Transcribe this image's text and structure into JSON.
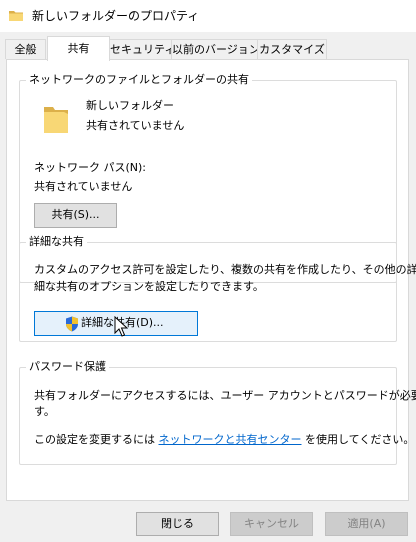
{
  "window": {
    "title": "新しいフォルダーのプロパティ",
    "icon": "folder-icon"
  },
  "tabs": [
    {
      "label": "全般",
      "active": false
    },
    {
      "label": "共有",
      "active": true
    },
    {
      "label": "セキュリティ",
      "active": false
    },
    {
      "label": "以前のバージョン",
      "active": false
    },
    {
      "label": "カスタマイズ",
      "active": false
    }
  ],
  "network_share": {
    "title": "ネットワークのファイルとフォルダーの共有",
    "folder_name": "新しいフォルダー",
    "folder_status": "共有されていません",
    "network_path_label": "ネットワーク パス(N):",
    "network_path_value": "共有されていません",
    "share_button": "共有(S)..."
  },
  "advanced_share": {
    "title": "詳細な共有",
    "description_line1": "カスタムのアクセス許可を設定したり、複数の共有を作成したり、その他の詳",
    "description_line2": "細な共有のオプションを設定したりできます。",
    "button": "詳細な共有(D)...",
    "button_icon": "uac-shield-icon"
  },
  "password_protection": {
    "title": "パスワード保護",
    "line1": "共有フォルダーにアクセスするには、ユーザー アカウントとパスワードが必要で",
    "line2": "す。",
    "line3_prefix": "この設定を変更するには ",
    "line3_link": "ネットワークと共有センター",
    "line3_suffix": " を使用してください。"
  },
  "footer": {
    "close": "閉じる",
    "cancel": "キャンセル",
    "apply": "適用(A)"
  },
  "colors": {
    "folder_yellow": "#f8d775",
    "link_blue": "#0066cc",
    "focus_blue": "#0078d7"
  }
}
